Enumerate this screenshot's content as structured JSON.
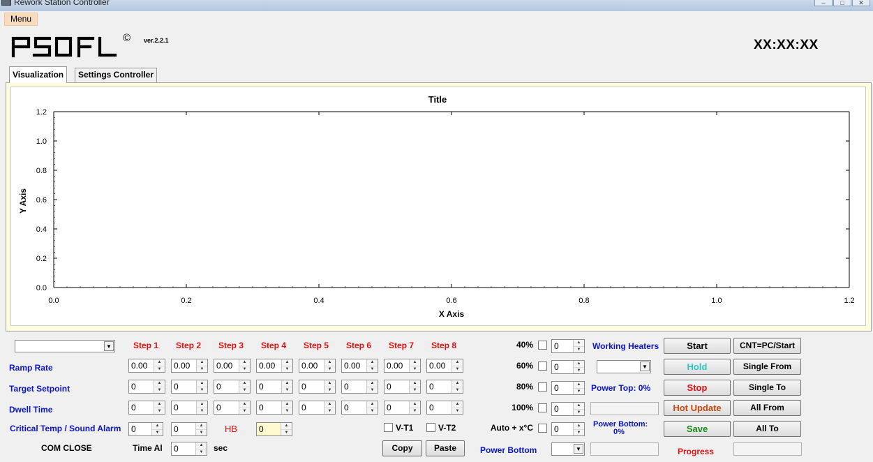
{
  "window": {
    "title": "Rework Station Controller"
  },
  "menu": {
    "label": "Menu"
  },
  "header": {
    "version": "ver.2.2.1",
    "copyright": "©",
    "clock": "XX:XX:XX"
  },
  "tabs": [
    {
      "label": "Visualization"
    },
    {
      "label": "Settings Controller"
    }
  ],
  "chart_data": {
    "type": "line",
    "title": "Title",
    "xlabel": "X Axis",
    "ylabel": "Y Axis",
    "xlim": [
      0,
      1.2
    ],
    "ylim": [
      0,
      1.2
    ],
    "xticks": [
      "0.0",
      "0.2",
      "0.4",
      "0.6",
      "0.8",
      "1.0",
      "1.2"
    ],
    "yticks": [
      "0.0",
      "0.2",
      "0.4",
      "0.6",
      "0.8",
      "1.0",
      "1.2"
    ],
    "series": [],
    "grid": false
  },
  "profile": {
    "steps": [
      "Step 1",
      "Step 2",
      "Step 3",
      "Step 4",
      "Step 5",
      "Step 6",
      "Step 7",
      "Step 8"
    ],
    "rows": {
      "ramp_rate": {
        "label": "Ramp Rate",
        "values": [
          "0.00",
          "0.00",
          "0.00",
          "0.00",
          "0.00",
          "0.00",
          "0.00",
          "0.00"
        ]
      },
      "target_setpoint": {
        "label": "Target Setpoint",
        "values": [
          "0",
          "0",
          "0",
          "0",
          "0",
          "0",
          "0",
          "0"
        ]
      },
      "dwell_time": {
        "label": "Dwell Time",
        "values": [
          "0",
          "0",
          "0",
          "0",
          "0",
          "0",
          "0",
          "0"
        ]
      }
    },
    "critical": {
      "label": "Critical Temp / Sound Alarm",
      "values": [
        "0",
        "0"
      ]
    },
    "hb": {
      "label": "HB",
      "value": "0"
    },
    "vt1": {
      "label": "V-T1"
    },
    "vt2": {
      "label": "V-T2"
    },
    "com_status": "COM CLOSE",
    "time_al": {
      "label": "Time Al",
      "value": "0",
      "unit": "sec"
    },
    "copy_label": "Copy",
    "paste_label": "Paste"
  },
  "heaters": {
    "rows": [
      {
        "label": "40%",
        "value": "0"
      },
      {
        "label": "60%",
        "value": "0"
      },
      {
        "label": "80%",
        "value": "0"
      },
      {
        "label": "100%",
        "value": "0"
      },
      {
        "label": "Auto + x°C",
        "value": "0"
      }
    ],
    "working_heaters_label": "Working Heaters",
    "power_top": "Power Top: 0%",
    "power_bottom_line1": "Power Bottom:",
    "power_bottom_line2": "0%",
    "power_bottom_label": "Power Bottom"
  },
  "actions": {
    "start": "Start",
    "hold": "Hold",
    "stop": "Stop",
    "hot_update": "Hot Update",
    "save": "Save",
    "progress": "Progress",
    "cnt_pc_start": "CNT=PC/Start",
    "single_from": "Single From",
    "single_to": "Single To",
    "all_from": "All From",
    "all_to": "All To"
  },
  "colors": {
    "hold": "#2ec4c4",
    "stop": "#e01010",
    "hot_update": "#c84a10",
    "save": "#1a8a1a",
    "label_blue": "#0b14c8",
    "label_red": "#e01010"
  }
}
